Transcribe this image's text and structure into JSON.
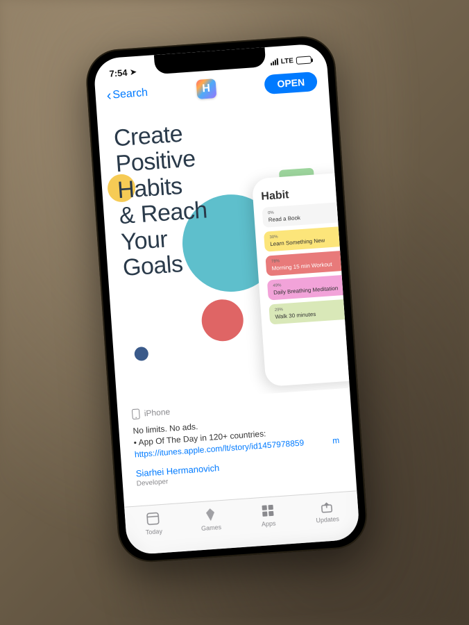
{
  "status": {
    "time": "7:54",
    "network": "LTE"
  },
  "nav": {
    "back": "Search",
    "app_letter": "H",
    "open": "OPEN"
  },
  "promo": {
    "headline": "Create\nPositive\nHabits\n& Reach\nYour\nGoals"
  },
  "mock": {
    "title": "Habit",
    "items": [
      {
        "pct": "0%",
        "label": "Read a Book"
      },
      {
        "pct": "30%",
        "label": "Learn Something New"
      },
      {
        "pct": "78%",
        "label": "Morning 15 min Workout"
      },
      {
        "pct": "49%",
        "label": "Daily Breathing Meditation"
      },
      {
        "pct": "29%",
        "label": "Walk 30 minutes"
      }
    ]
  },
  "meta": {
    "platform": "iPhone"
  },
  "desc": {
    "line1": "No limits. No ads.",
    "line2": "• App Of The Day in 120+ countries:",
    "url": "https://itunes.apple.com/lt/story/id1457978859",
    "more": "m"
  },
  "developer": {
    "name": "Siarhei Hermanovich",
    "label": "Developer"
  },
  "tabs": {
    "today": "Today",
    "games": "Games",
    "apps": "Apps",
    "updates": "Updates"
  }
}
